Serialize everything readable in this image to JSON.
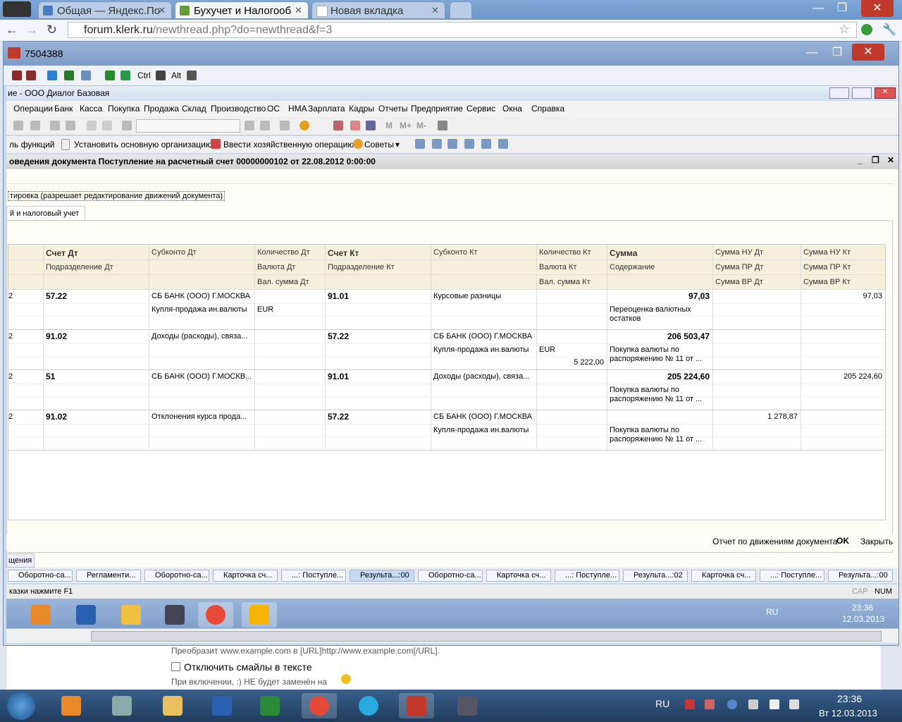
{
  "browser": {
    "tabs": [
      {
        "label": "Общая — Яндекс.По",
        "icon_color": "#4a7cc2"
      },
      {
        "label": "Бухучет и Налогооб",
        "icon_color": "#6b9a3c"
      },
      {
        "label": "Новая вкладка",
        "icon_color": "#ffffff"
      }
    ],
    "url_host": "forum.klerk.ru",
    "url_path": "/newthread.php?do=newthread&f=3"
  },
  "app": {
    "window_title": "7504388",
    "inner_title": "ие - ООО Диалог Базовая",
    "toolbar_text": [
      "Ctrl",
      "Alt"
    ],
    "menu": [
      "Операции",
      "Банк",
      "Касса",
      "Покупка",
      "Продажа",
      "Склад",
      "Производство",
      "ОС",
      "НМА",
      "Зарплата",
      "Кадры",
      "Отчеты",
      "Предприятие",
      "Сервис",
      "Окна",
      "Справка"
    ],
    "toolbar2_items": [
      "M",
      "M+",
      "M-"
    ],
    "toolbar3": {
      "functions": "ль функций",
      "set_org": "Установить основную организацию",
      "enter_op": "Ввести хозяйственную операцию",
      "tips": "Советы"
    },
    "doc_title": "оведения документа Поступление на расчетный счет 00000000102 от 22.08.2012 0:00:00",
    "edit_mode_label": "тировка (разрешает редактирование движений документа)",
    "tab_label": "й и налоговый учет",
    "grid": {
      "headers_row1": [
        "Счет Дт",
        "Субконто Дт",
        "Количество Дт",
        "Счет Кт",
        "Субконто Кт",
        "Количество Кт",
        "Сумма",
        "Сумма НУ Дт",
        "Сумма НУ Кт"
      ],
      "headers_row2": [
        "Подразделение Дт",
        "",
        "Валюта Дт",
        "Подразделение Кт",
        "",
        "Валюта Кт",
        "Содержание",
        "Сумма ПР Дт",
        "Сумма ПР Кт"
      ],
      "headers_row3": [
        "",
        "",
        "Вал. сумма Дт",
        "",
        "",
        "Вал. сумма Кт",
        "",
        "Сумма ВР Дт",
        "Сумма ВР Кт"
      ],
      "rows": [
        {
          "n": "2",
          "acc_dt": "57.22",
          "sub_dt1": "СБ БАНК (ООО) Г.МОСКВА",
          "sub_dt2": "Купля-продажа ин.валюты",
          "cur_dt": "EUR",
          "acc_kt": "91.01",
          "sub_kt1": "Курсовые разницы",
          "sub_kt2": "",
          "cur_kt": "",
          "val_kt": "",
          "sum": "97,03",
          "desc1": "Переоценка валютных",
          "desc2": "остатков",
          "nu_dt": "",
          "nu_kt": "97,03"
        },
        {
          "n": "2",
          "acc_dt": "91.02",
          "sub_dt1": "Доходы (расходы), связа...",
          "sub_dt2": "",
          "cur_dt": "",
          "acc_kt": "57.22",
          "sub_kt1": "СБ БАНК (ООО) Г.МОСКВА",
          "sub_kt2": "Купля-продажа ин.валюты",
          "cur_kt": "EUR",
          "val_kt": "5 222,00",
          "sum": "206 503,47",
          "desc1": "Покупка валюты по",
          "desc2": "распоряжению № 11 от ...",
          "nu_dt": "",
          "nu_kt": ""
        },
        {
          "n": "2",
          "acc_dt": "51",
          "sub_dt1": "СБ БАНК (ООО) Г.МОСКВ...",
          "sub_dt2": "",
          "cur_dt": "",
          "acc_kt": "91.01",
          "sub_kt1": "Доходы (расходы), связа...",
          "sub_kt2": "",
          "cur_kt": "",
          "val_kt": "",
          "sum": "205 224,60",
          "desc1": "Покупка валюты по",
          "desc2": "распоряжению № 11 от ...",
          "nu_dt": "",
          "nu_kt": "205 224,60"
        },
        {
          "n": "2",
          "acc_dt": "91.02",
          "sub_dt1": "Отклонения курса прода...",
          "sub_dt2": "",
          "cur_dt": "",
          "acc_kt": "57.22",
          "sub_kt1": "СБ БАНК (ООО) Г.МОСКВА",
          "sub_kt2": "Купля-продажа ин.валюты",
          "cur_kt": "",
          "val_kt": "",
          "sum": "",
          "desc1": "Покупка валюты по",
          "desc2": "распоряжению № 11 от ...",
          "nu_dt": "1 278,87",
          "nu_kt": ""
        }
      ]
    },
    "footer": {
      "report": "Отчет по движениям документа",
      "ok": "OK",
      "close": "Закрыть"
    },
    "left_tab": "щения",
    "tasks": [
      "Оборотно-са...",
      "Регламенти...",
      "Оборотно-са...",
      "Карточка сч...",
      "...: Поступле...",
      "Результа...:00",
      "Оборотно-са...",
      "Карточка сч...",
      "...: Поступле...",
      "Результа...:02",
      "Карточка сч...",
      "...: Поступле...",
      "Результа...:00"
    ],
    "status_hint": "казки нажмите F1",
    "status_cap": "CAP",
    "status_num": "NUM",
    "inner_tray": {
      "lang": "RU",
      "time": "23:36",
      "date": "12.03.2013"
    }
  },
  "web_below": {
    "line1": "Преобразит www.example.com в [URL]http://www.example.com[/URL].",
    "checkbox_label": "Отключить смайлы в тексте",
    "line3": "При включении, :) НЕ будет заменён на"
  },
  "taskbar": {
    "lang": "RU",
    "time": "23:36",
    "date": "Вт 12.03.2013"
  },
  "colors": {
    "taskbar": "#1f3c5e",
    "header_bg": "#f5f0dc",
    "selected_task": "#c8daf3"
  }
}
